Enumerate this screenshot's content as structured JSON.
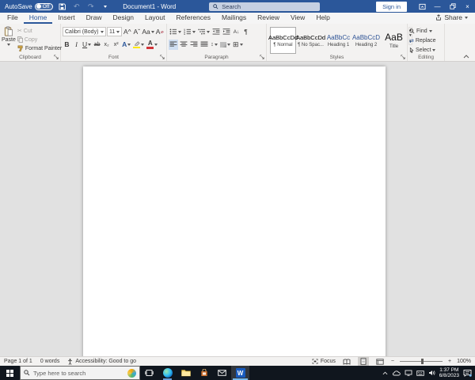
{
  "titlebar": {
    "autosave_label": "AutoSave",
    "autosave_state": "Off",
    "title": "Document1 - Word",
    "search_placeholder": "Search",
    "sign_in": "Sign in"
  },
  "tabs": [
    "File",
    "Home",
    "Insert",
    "Draw",
    "Design",
    "Layout",
    "References",
    "Mailings",
    "Review",
    "View",
    "Help"
  ],
  "share_label": "Share",
  "ribbon": {
    "clipboard": {
      "label": "Clipboard",
      "paste": "Paste",
      "cut": "Cut",
      "copy": "Copy",
      "format_painter": "Format Painter"
    },
    "font": {
      "label": "Font",
      "family": "Calibri (Body)",
      "size": "11",
      "bold": "B",
      "italic": "I",
      "underline": "U",
      "strikethrough": "ab",
      "subscript": "x₂",
      "superscript": "x²",
      "grow_font": "A^",
      "shrink_font": "Aˇ",
      "change_case": "Aa",
      "clear_formatting": "A",
      "text_effects": "A",
      "font_color": "A"
    },
    "paragraph": {
      "label": "Paragraph"
    },
    "styles": {
      "label": "Styles",
      "items": [
        {
          "preview": "AaBbCcDd",
          "name": "¶ Normal"
        },
        {
          "preview": "AaBbCcDd",
          "name": "¶ No Spac..."
        },
        {
          "preview": "AaBbCc",
          "name": "Heading 1"
        },
        {
          "preview": "AaBbCcD",
          "name": "Heading 2"
        },
        {
          "preview": "AaB",
          "name": "Title"
        }
      ]
    },
    "editing": {
      "label": "Editing",
      "find": "Find",
      "replace": "Replace",
      "select": "Select"
    }
  },
  "statusbar": {
    "page": "Page 1 of 1",
    "words": "0 words",
    "accessibility": "Accessibility: Good to go",
    "focus": "Focus",
    "zoom": "100%"
  },
  "taskbar": {
    "search_placeholder": "Type here to search",
    "time": "1:37 PM",
    "date": "6/8/2023"
  },
  "icons": {
    "chevron_down": "▾",
    "undo": "↶",
    "redo": "↷",
    "scissors": "✂",
    "pilcrow": "¶",
    "sort": "A↓",
    "line_spacing": "↕",
    "borders": "⊞",
    "replace": "⇄",
    "minimize": "—",
    "close": "×",
    "gallery_up": "▴",
    "gallery_down": "▾",
    "zoom_out": "−",
    "zoom_in": "+"
  },
  "colors": {
    "titlebar": "#2b579a",
    "heading": "#2F5496",
    "word_icon": "#185abd"
  }
}
